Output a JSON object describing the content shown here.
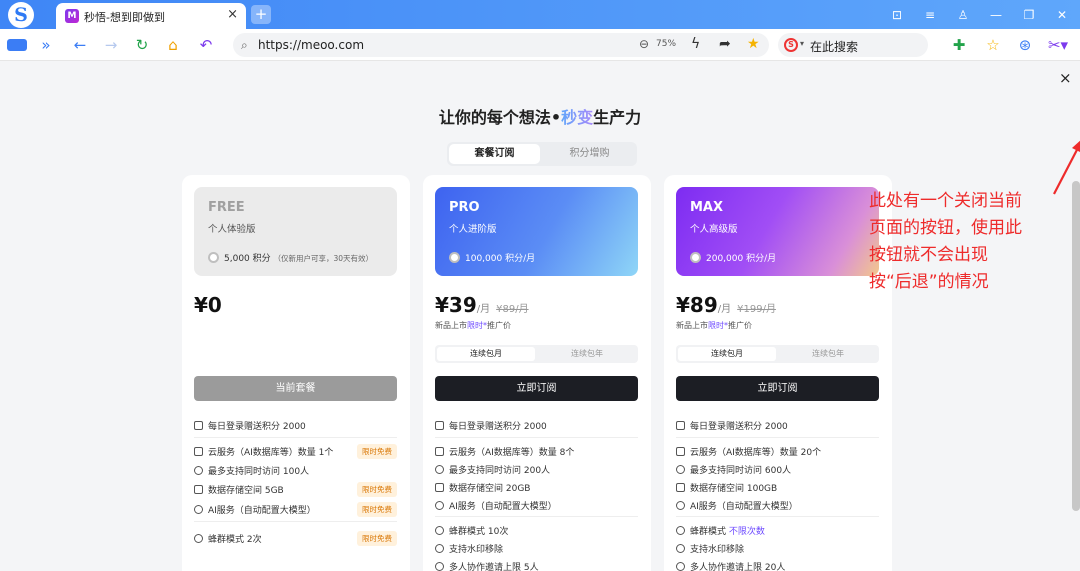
{
  "browser": {
    "logo": "S",
    "tab": {
      "favicon": "M",
      "title": "秒悟-想到即做到",
      "close": "×"
    },
    "newtab": "+",
    "window_controls": [
      {
        "name": "tab-list-icon",
        "glyph": "⊡"
      },
      {
        "name": "menu-icon",
        "glyph": "≡"
      },
      {
        "name": "skin-icon",
        "glyph": "♙"
      },
      {
        "name": "minimize-icon",
        "glyph": "—"
      },
      {
        "name": "restore-icon",
        "glyph": "❐"
      },
      {
        "name": "close-window-icon",
        "glyph": "✕"
      }
    ],
    "url": "https://meoo.com",
    "zoom": "75%",
    "search_placeholder": "在此搜索"
  },
  "page": {
    "close_glyph": "×",
    "headline_pre": "让你的每个想法•",
    "headline_accent": "秒变",
    "headline_post": "生产力",
    "tabs": [
      {
        "label": "套餐订阅",
        "active": true
      },
      {
        "label": "积分增购",
        "active": false
      }
    ]
  },
  "plans": [
    {
      "id": "free",
      "name": "FREE",
      "sub": "个人体验版",
      "points": "5,000 积分",
      "points_note": "（仅新用户可享，30天有效）",
      "price": "¥0",
      "cta": "当前套餐",
      "features": [
        {
          "text": "每日登录赠送积分 2000"
        },
        {
          "text": "云服务（AI数据库等）数量 1个",
          "badge": "限时免费"
        },
        {
          "text": "最多支持同时访问 100人"
        },
        {
          "text": "数据存储空间 5GB",
          "badge": "限时免费"
        },
        {
          "text": "AI服务（自动配置大模型）",
          "badge": "限时免费"
        },
        {
          "text": "蜂群模式 2次",
          "badge": "限时免费"
        }
      ]
    },
    {
      "id": "pro",
      "name": "PRO",
      "sub": "个人进阶版",
      "points": "100,000 积分/月",
      "price": "¥39",
      "unit": "/月",
      "old_price": "¥89/月",
      "promo_pre": "新品上市",
      "promo_hl": "限时",
      "promo_post": "推广价",
      "billing": [
        "连续包月",
        "连续包年"
      ],
      "cta": "立即订阅",
      "features": [
        {
          "text": "每日登录赠送积分 2000"
        },
        {
          "text": "云服务（AI数据库等）数量 8个"
        },
        {
          "text": "最多支持同时访问 200人"
        },
        {
          "text": "数据存储空间 20GB"
        },
        {
          "text": "AI服务（自动配置大模型）"
        },
        {
          "text": "蜂群模式 10次"
        },
        {
          "text": "支持水印移除"
        },
        {
          "text": "多人协作邀请上限 5人"
        }
      ]
    },
    {
      "id": "max",
      "name": "MAX",
      "sub": "个人高级版",
      "points": "200,000 积分/月",
      "price": "¥89",
      "unit": "/月",
      "old_price": "¥199/月",
      "promo_pre": "新品上市",
      "promo_hl": "限时",
      "promo_post": "推广价",
      "billing": [
        "连续包月",
        "连续包年"
      ],
      "cta": "立即订阅",
      "features": [
        {
          "text": "每日登录赠送积分 2000"
        },
        {
          "text": "云服务（AI数据库等）数量 20个"
        },
        {
          "text": "最多支持同时访问 600人"
        },
        {
          "text": "数据存储空间 100GB"
        },
        {
          "text": "AI服务（自动配置大模型）"
        },
        {
          "text": "蜂群模式",
          "hl": "不限次数"
        },
        {
          "text": "支持水印移除"
        },
        {
          "text": "多人协作邀请上限 20人"
        }
      ]
    }
  ],
  "annotation": {
    "lines": [
      "此处有一个关闭当前",
      "页面的按钮，使用此",
      "按钮就不会出现",
      "按“后退”的情况"
    ],
    "color": "#ee2b2b"
  }
}
